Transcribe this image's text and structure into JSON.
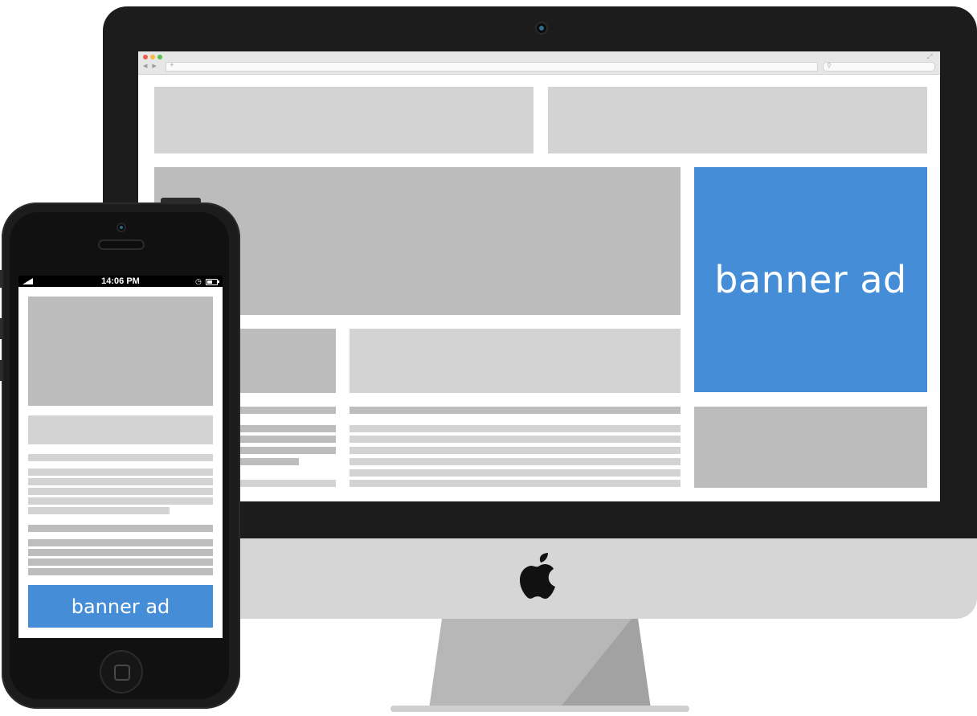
{
  "desktop": {
    "banner_text": "banner ad"
  },
  "mobile": {
    "status_time": "14:06 PM",
    "banner_text": "banner ad"
  },
  "colors": {
    "banner_blue": "#458ed7",
    "placeholder_light": "#d3d3d3",
    "placeholder_mid": "#bcbcbc",
    "device_black": "#1c1c1c",
    "imac_silver": "#d6d6d6"
  },
  "icons": {
    "brand": "apple-logo-icon",
    "status": [
      "signal-icon",
      "alarm-icon",
      "battery-icon"
    ]
  }
}
